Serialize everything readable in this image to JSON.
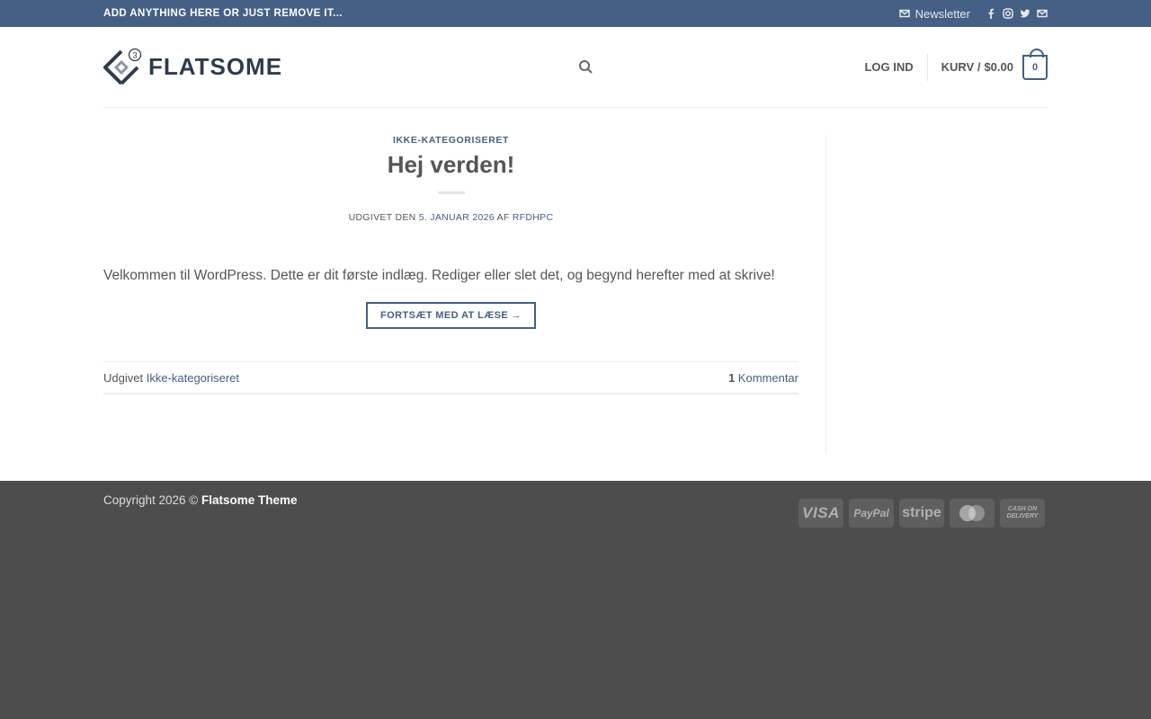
{
  "topbar": {
    "message": "ADD ANYTHING HERE OR JUST REMOVE IT...",
    "newsletter_label": "Newsletter",
    "icons": [
      "envelope-icon",
      "facebook-icon",
      "instagram-icon",
      "twitter-icon",
      "envelope-icon"
    ]
  },
  "header": {
    "logo_text": "FLATSOME",
    "logo_badge": "3",
    "login_label": "LOG IND",
    "cart_label": "KURV /",
    "cart_total": "$0.00",
    "cart_count": "0"
  },
  "post": {
    "category": "IKKE-KATEGORISERET",
    "title": "Hej verden!",
    "meta_prefix": "UDGIVET DEN",
    "meta_date": "5. JANUAR 2026",
    "meta_by": "AF",
    "meta_author": "RFDHPC",
    "excerpt": "Velkommen til WordPress. Dette er dit første indlæg. Rediger eller slet det, og begynd herefter med at skrive!",
    "readmore_label": "FORTSÆT MED AT LÆSE →",
    "footer_posted": "Udgivet",
    "footer_category": "Ikke-kategoriseret",
    "comment_count": "1",
    "comment_label": "Kommentar"
  },
  "footer": {
    "copyright_prefix": "Copyright 2026 ©",
    "copyright_name": "Flatsome Theme",
    "payments": {
      "visa": "VISA",
      "paypal": "PayPal",
      "stripe": "stripe",
      "cod": "CASH ON DELIVERY"
    }
  },
  "colors": {
    "primary": "#446084",
    "footer_bg": "#4d4d4d",
    "text": "#555555"
  }
}
